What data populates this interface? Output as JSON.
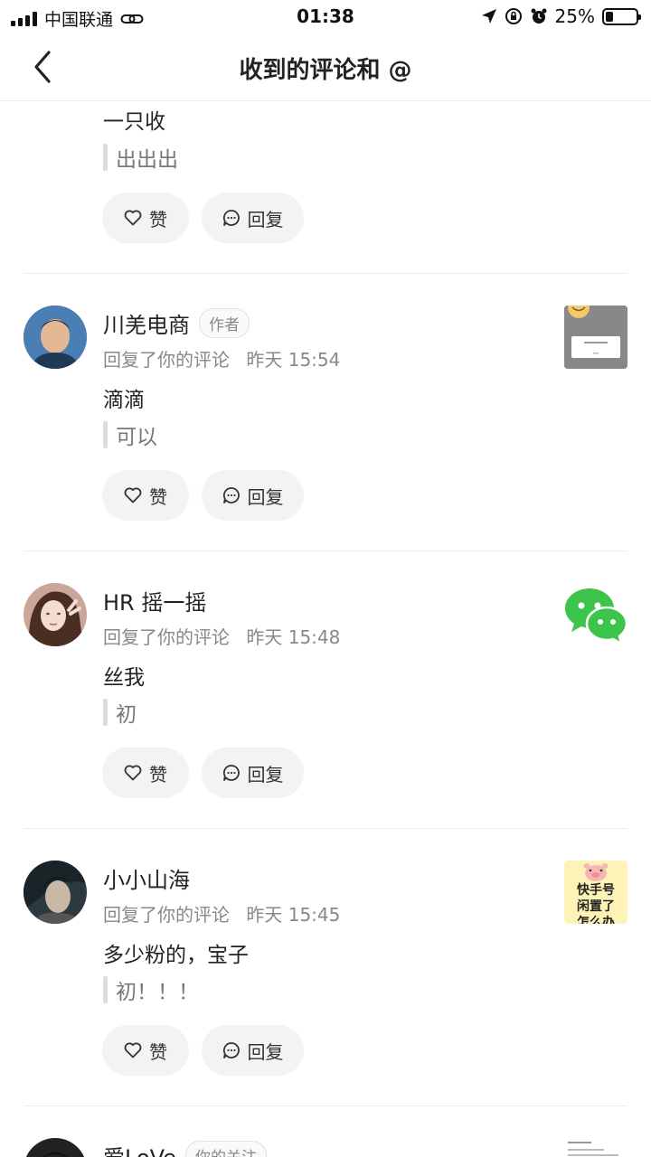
{
  "status_bar": {
    "carrier": "中国联通",
    "time": "01:38",
    "battery": "25%",
    "battery_level": 0.25
  },
  "header": {
    "title": "收到的评论和 @"
  },
  "partial_item": {
    "comment": "一只收",
    "quote": "出出出",
    "like_label": "赞",
    "reply_label": "回复"
  },
  "items": [
    {
      "name": "川羌电商",
      "badge": "作者",
      "action": "回复了你的评论",
      "time": "昨天 15:54",
      "comment": "滴滴",
      "quote": "可以",
      "like_label": "赞",
      "reply_label": "回复"
    },
    {
      "name": "HR 摇一摇",
      "action": "回复了你的评论",
      "time": "昨天 15:48",
      "comment": "丝我",
      "quote": "初",
      "like_label": "赞",
      "reply_label": "回复"
    },
    {
      "name": "小小山海",
      "action": "回复了你的评论",
      "time": "昨天 15:45",
      "comment": "多少粉的，宝子",
      "quote": "初！！！",
      "like_label": "赞",
      "reply_label": "回复",
      "thumb_text": "快手号 闲置了 怎么办"
    },
    {
      "name": "爱LoVe",
      "badge": "你的关注"
    }
  ],
  "colors": {
    "button_bg": "#f3f3f5",
    "meta_gray": "#888888",
    "wechat_green": "#3dc44a"
  }
}
